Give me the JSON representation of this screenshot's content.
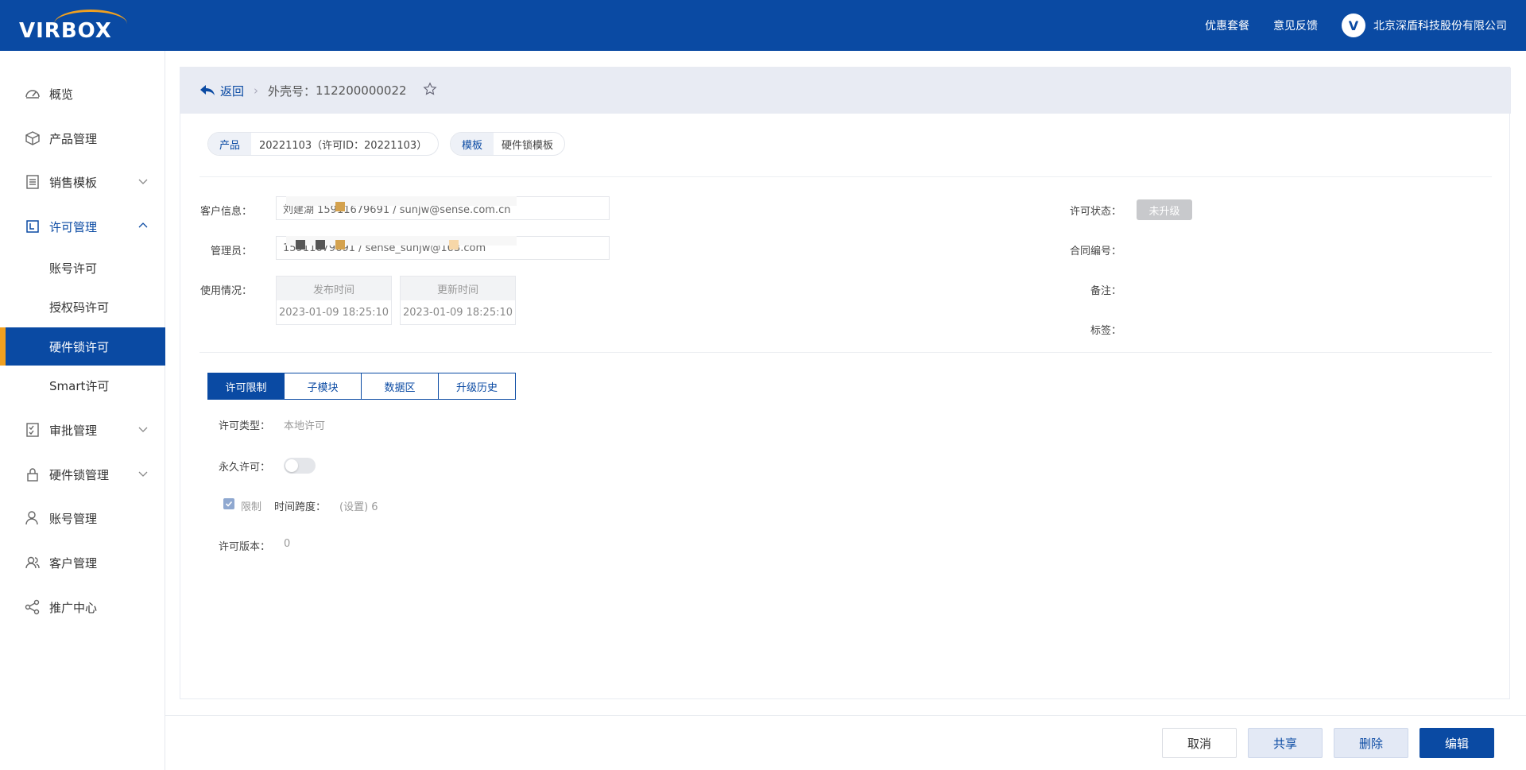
{
  "header": {
    "logo_text": "VIRBOX",
    "links": [
      "优惠套餐",
      "意见反馈"
    ],
    "company_logo": "V",
    "company_name": "北京深盾科技股份有限公司"
  },
  "sidebar": {
    "items": [
      {
        "label": "概览",
        "icon": "dashboard-icon"
      },
      {
        "label": "产品管理",
        "icon": "box-icon"
      },
      {
        "label": "销售模板",
        "icon": "list-icon"
      },
      {
        "label": "许可管理",
        "icon": "license-icon"
      },
      {
        "label": "审批管理",
        "icon": "approval-icon"
      },
      {
        "label": "硬件锁管理",
        "icon": "lock-icon"
      },
      {
        "label": "账号管理",
        "icon": "user-icon"
      },
      {
        "label": "客户管理",
        "icon": "customers-icon"
      },
      {
        "label": "推广中心",
        "icon": "share-icon"
      }
    ],
    "license_sub": [
      "账号许可",
      "授权码许可",
      "硬件锁许可",
      "Smart许可"
    ]
  },
  "breadcrumb": {
    "back": "返回",
    "label": "外壳号：",
    "value": "112200000022"
  },
  "product": {
    "tag": "产品",
    "value": "20221103（许可ID：20221103）"
  },
  "template": {
    "tag": "模板",
    "value": "硬件锁模板"
  },
  "fields": {
    "customer_label": "客户信息：",
    "customer_value": "刘建湖 15911679691 / sunjw@sense.com.cn",
    "admin_label": "管理员：",
    "admin_value": "15911679691 / sense_sunjw@163.com",
    "usage_label": "使用情况：",
    "publish_time_label": "发布时间",
    "publish_time": "2023-01-09 18:25:10",
    "update_time_label": "更新时间",
    "update_time": "2023-01-09 18:25:10",
    "status_label": "许可状态：",
    "status_value": "未升级",
    "contract_label": "合同编号：",
    "remark_label": "备注：",
    "tags_label": "标签："
  },
  "tabs": [
    "许可限制",
    "子模块",
    "数据区",
    "升级历史"
  ],
  "limits": {
    "type_label": "许可类型：",
    "type_value": "本地许可",
    "permanent_label": "永久许可：",
    "limit_label": "限制",
    "span_label": "时间跨度：",
    "span_value": "(设置) 6",
    "version_label": "许可版本：",
    "version_value": "0"
  },
  "footer": {
    "cancel": "取消",
    "share": "共享",
    "delete": "删除",
    "edit": "编辑"
  },
  "colors": {
    "primary": "#0a4aa3",
    "accent": "#f0a020"
  }
}
